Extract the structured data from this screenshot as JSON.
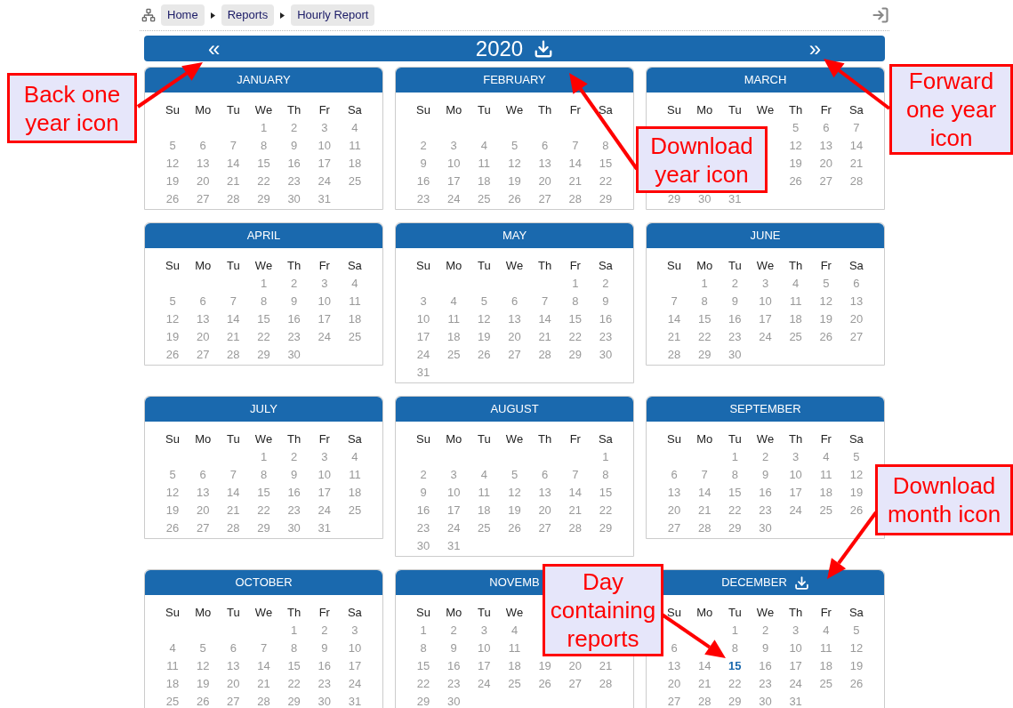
{
  "breadcrumb": [
    "Home",
    "Reports",
    "Hourly Report"
  ],
  "year_bar": {
    "prev": "«",
    "year": "2020",
    "next": "»"
  },
  "months": [
    {
      "name": "JANUARY",
      "download": false,
      "weekdays": [
        "Su",
        "Mo",
        "Tu",
        "We",
        "Th",
        "Fr",
        "Sa"
      ],
      "weeks": [
        [
          "1",
          "2",
          "3",
          "4"
        ],
        [
          "5",
          "6",
          "7",
          "8",
          "9",
          "10",
          "11"
        ],
        [
          "12",
          "13",
          "14",
          "15",
          "16",
          "17",
          "18"
        ],
        [
          "19",
          "20",
          "21",
          "22",
          "23",
          "24",
          "25"
        ],
        [
          "26",
          "27",
          "28",
          "29",
          "30",
          "31"
        ]
      ]
    },
    {
      "name": "FEBRUARY",
      "download": false,
      "covered_first_week": true,
      "weekdays": [
        "Su",
        "Mo",
        "Tu",
        "We",
        "Th",
        "Fr",
        "Sa"
      ],
      "weeks": [
        [
          "2",
          "3",
          "4",
          "5",
          "6",
          "7",
          "8"
        ],
        [
          "9",
          "10",
          "11",
          "12",
          "13",
          "14",
          "15"
        ],
        [
          "16",
          "17",
          "18",
          "19",
          "20",
          "21",
          "22"
        ],
        [
          "23",
          "24",
          "25",
          "26",
          "27",
          "28",
          "29"
        ]
      ]
    },
    {
      "name": "MARCH",
      "download": false,
      "weekdays": [
        "Su",
        "Mo",
        "Tu",
        "We",
        "Th",
        "Fr",
        "Sa"
      ],
      "weeks": [
        {
          "end": [
            "5",
            "6",
            "7"
          ]
        },
        {
          "end": [
            "12",
            "13",
            "14"
          ]
        },
        {
          "end": [
            "19",
            "20",
            "21"
          ]
        },
        {
          "end": [
            "26",
            "27",
            "28"
          ]
        },
        [
          "29",
          "30",
          "31"
        ]
      ]
    },
    {
      "name": "APRIL",
      "download": false,
      "weekdays": [
        "Su",
        "Mo",
        "Tu",
        "We",
        "Th",
        "Fr",
        "Sa"
      ],
      "weeks": [
        [
          "1",
          "2",
          "3",
          "4"
        ],
        [
          "5",
          "6",
          "7",
          "8",
          "9",
          "10",
          "11"
        ],
        [
          "12",
          "13",
          "14",
          "15",
          "16",
          "17",
          "18"
        ],
        [
          "19",
          "20",
          "21",
          "22",
          "23",
          "24",
          "25"
        ],
        [
          "26",
          "27",
          "28",
          "29",
          "30"
        ]
      ]
    },
    {
      "name": "MAY",
      "download": false,
      "weekdays": [
        "Su",
        "Mo",
        "Tu",
        "We",
        "Th",
        "Fr",
        "Sa"
      ],
      "weeks": [
        [
          "1",
          "2"
        ],
        [
          "3",
          "4",
          "5",
          "6",
          "7",
          "8",
          "9"
        ],
        [
          "10",
          "11",
          "12",
          "13",
          "14",
          "15",
          "16"
        ],
        [
          "17",
          "18",
          "19",
          "20",
          "21",
          "22",
          "23"
        ],
        [
          "24",
          "25",
          "26",
          "27",
          "28",
          "29",
          "30"
        ],
        [
          "31"
        ]
      ]
    },
    {
      "name": "JUNE",
      "download": false,
      "weekdays": [
        "Su",
        "Mo",
        "Tu",
        "We",
        "Th",
        "Fr",
        "Sa"
      ],
      "weeks": [
        [
          "1",
          "2",
          "3",
          "4",
          "5",
          "6"
        ],
        [
          "7",
          "8",
          "9",
          "10",
          "11",
          "12",
          "13"
        ],
        [
          "14",
          "15",
          "16",
          "17",
          "18",
          "19",
          "20"
        ],
        [
          "21",
          "22",
          "23",
          "24",
          "25",
          "26",
          "27"
        ],
        [
          "28",
          "29",
          "30"
        ]
      ]
    },
    {
      "name": "JULY",
      "download": false,
      "weekdays": [
        "Su",
        "Mo",
        "Tu",
        "We",
        "Th",
        "Fr",
        "Sa"
      ],
      "weeks": [
        [
          "1",
          "2",
          "3",
          "4"
        ],
        [
          "5",
          "6",
          "7",
          "8",
          "9",
          "10",
          "11"
        ],
        [
          "12",
          "13",
          "14",
          "15",
          "16",
          "17",
          "18"
        ],
        [
          "19",
          "20",
          "21",
          "22",
          "23",
          "24",
          "25"
        ],
        [
          "26",
          "27",
          "28",
          "29",
          "30",
          "31"
        ]
      ]
    },
    {
      "name": "AUGUST",
      "download": false,
      "weekdays": [
        "Su",
        "Mo",
        "Tu",
        "We",
        "Th",
        "Fr",
        "Sa"
      ],
      "weeks": [
        [
          "1"
        ],
        [
          "2",
          "3",
          "4",
          "5",
          "6",
          "7",
          "8"
        ],
        [
          "9",
          "10",
          "11",
          "12",
          "13",
          "14",
          "15"
        ],
        [
          "16",
          "17",
          "18",
          "19",
          "20",
          "21",
          "22"
        ],
        [
          "23",
          "24",
          "25",
          "26",
          "27",
          "28",
          "29"
        ],
        [
          "30",
          "31"
        ]
      ]
    },
    {
      "name": "SEPTEMBER",
      "download": false,
      "weekdays": [
        "Su",
        "Mo",
        "Tu",
        "We",
        "Th",
        "Fr",
        "Sa"
      ],
      "weeks": [
        [
          "1",
          "2",
          "3",
          "4",
          "5"
        ],
        [
          "6",
          "7",
          "8",
          "9",
          "10",
          "11",
          "12"
        ],
        [
          "13",
          "14",
          "15",
          "16",
          "17",
          "18",
          "19"
        ],
        [
          "20",
          "21",
          "22",
          "23",
          "24",
          "25",
          "26"
        ],
        [
          "27",
          "28",
          "29",
          "30"
        ]
      ]
    },
    {
      "name": "OCTOBER",
      "download": false,
      "weekdays": [
        "Su",
        "Mo",
        "Tu",
        "We",
        "Th",
        "Fr",
        "Sa"
      ],
      "weeks": [
        [
          "1",
          "2",
          "3"
        ],
        [
          "4",
          "5",
          "6",
          "7",
          "8",
          "9",
          "10"
        ],
        [
          "11",
          "12",
          "13",
          "14",
          "15",
          "16",
          "17"
        ],
        [
          "18",
          "19",
          "20",
          "21",
          "22",
          "23",
          "24"
        ],
        [
          "25",
          "26",
          "27",
          "28",
          "29",
          "30",
          "31"
        ]
      ]
    },
    {
      "name": "NOVEMB",
      "download": false,
      "weekdays": [
        "Su",
        "Mo",
        "Tu",
        "We"
      ],
      "weeks": [
        {
          "start": [
            "1",
            "2",
            "3",
            "4"
          ]
        },
        {
          "start": [
            "8",
            "9",
            "10",
            "11"
          ]
        },
        [
          "15",
          "16",
          "17",
          "18",
          "19",
          "20",
          "21"
        ],
        [
          "22",
          "23",
          "24",
          "25",
          "26",
          "27",
          "28"
        ],
        [
          "29",
          "30"
        ]
      ]
    },
    {
      "name": "DECEMBER",
      "download": true,
      "weekdays": [
        "Su",
        "Mo",
        "Tu",
        "We",
        "Th",
        "Fr",
        "Sa"
      ],
      "weeks": [
        [
          "1",
          "2",
          "3",
          "4",
          "5"
        ],
        {
          "start": [
            "6"
          ],
          "end": [
            "8",
            "9",
            "10",
            "11",
            "12"
          ]
        },
        [
          "13",
          "14",
          {
            "day": "15",
            "has_reports": true
          },
          "16",
          "17",
          "18",
          "19"
        ],
        [
          "20",
          "21",
          "22",
          "23",
          "24",
          "25",
          "26"
        ],
        [
          "27",
          "28",
          "29",
          "30",
          "31"
        ]
      ]
    }
  ],
  "callouts": [
    "Back one year icon",
    "Download year icon",
    "Forward one year icon",
    "Download month icon",
    "Day containing reports"
  ]
}
